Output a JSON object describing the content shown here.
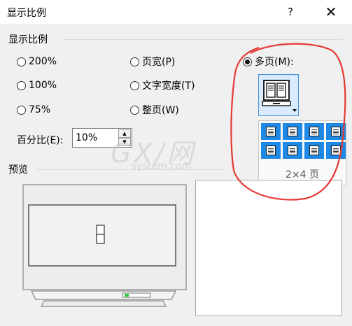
{
  "window": {
    "title": "显示比例",
    "help_label": "?",
    "close_label": "✕"
  },
  "zoom_group": {
    "label": "显示比例",
    "options": {
      "p200": "200%",
      "p100": "100%",
      "p75": "75%",
      "page_width": "页宽(P)",
      "text_width": "文字宽度(T)",
      "whole_page": "整页(W)",
      "multi_page": "多页(M):"
    },
    "selected": "multi_page",
    "percent_label": "百分比(E):",
    "percent_value": "10%"
  },
  "multi_page_picker": {
    "icon": "monitor-pages-icon",
    "rows": 2,
    "columns": 4,
    "status": "2×4 页"
  },
  "preview": {
    "label": "预览",
    "icon": "monitor-icon"
  },
  "watermark": {
    "text": "GX/网",
    "subtext": "system.com"
  },
  "colors": {
    "accent": "#1e88e5",
    "annotation": "#e53935"
  }
}
